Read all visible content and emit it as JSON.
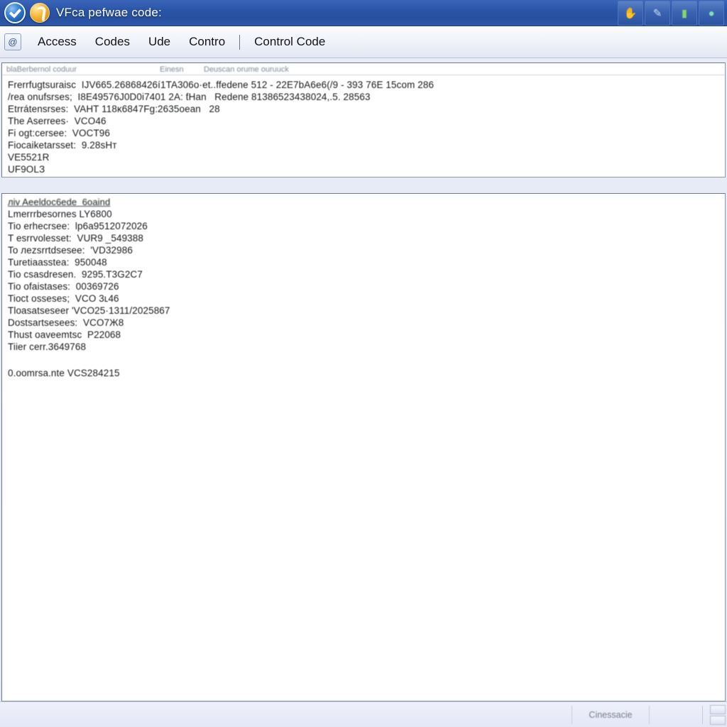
{
  "window": {
    "title": "VFca pefwae code:",
    "icons": {
      "app_primary": "blue-check-circle-icon",
      "app_secondary": "orange-swirl-circle-icon"
    },
    "titlebar_buttons": [
      {
        "name": "thumbs-up-icon",
        "glyph": "✋"
      },
      {
        "name": "wrench-tool-icon",
        "glyph": "✒"
      },
      {
        "name": "car-icon",
        "glyph": "▬"
      },
      {
        "name": "globe-icon",
        "glyph": "●"
      }
    ]
  },
  "menubar": {
    "app_icon": "at-sign-icon",
    "items": [
      {
        "label": "Access"
      },
      {
        "label": "Codes"
      },
      {
        "label": "Ude"
      },
      {
        "label": "Contro"
      }
    ],
    "separator": "|",
    "trailing": [
      {
        "label": "Control Code"
      }
    ]
  },
  "panel_top": {
    "columns": [
      "blaBerbernol coduur",
      "Einesn",
      "Deuscan orume ouruuck"
    ],
    "rows": [
      "Frerrfugtsuraisc  IJV665.26868426í1TA306o·et..ffedene 512 - 22E7bA6e6(/9 - 393 76E 15com 286",
      "/rea onufsrses;  I8E49576J0D0i7401 2A: ƭHan   Redene 81386523438024,.5. 28563",
      "Etrrátensrses:  VAHT 118κ6847Fg:2635oean   28",
      "The Aserrees·  VCO46",
      "Fi ogt:cersee:  VOCT96",
      "Fiocaiketarsset:  9.28ѕHт",
      "VE5521R",
      "UF9OLЗ"
    ]
  },
  "panel_bottom": {
    "heading": "лiv Aeeldoc6ede  6oaind",
    "rows": [
      "Lmerrrbesornes LY6800",
      "Tio erhecrsee:  lр6a9512072026",
      "T esrrvolesset:  VUR9 _549388",
      "To лezsrrtdsesee:  'VD32986",
      "Turetiaasstea:  950048",
      "Tio csasdresen.  9295.T3G2С7",
      "Tio ofaistases:  00369726",
      "Tioct osseses;  VCO 3ʟ46",
      "Tloasatseseer 'VCO25·1311/2025867",
      "Dostsartsesees:  VCO7Ж8",
      "Thust oaveemtsc  Р22068",
      "Tiier cerr.3649768"
    ],
    "footer_row": "0.oomrsa.nte VCS284215"
  },
  "statusbar": {
    "cell_label": "Cinessacie"
  },
  "colors": {
    "titlebar": "#2a55a8",
    "menubar": "#eef1f8",
    "panel_background": "#ffffff",
    "panel_border": "#8f98ab",
    "status_background": "#e8ebf7",
    "text": "#17191c",
    "muted_text": "#7d8796"
  }
}
